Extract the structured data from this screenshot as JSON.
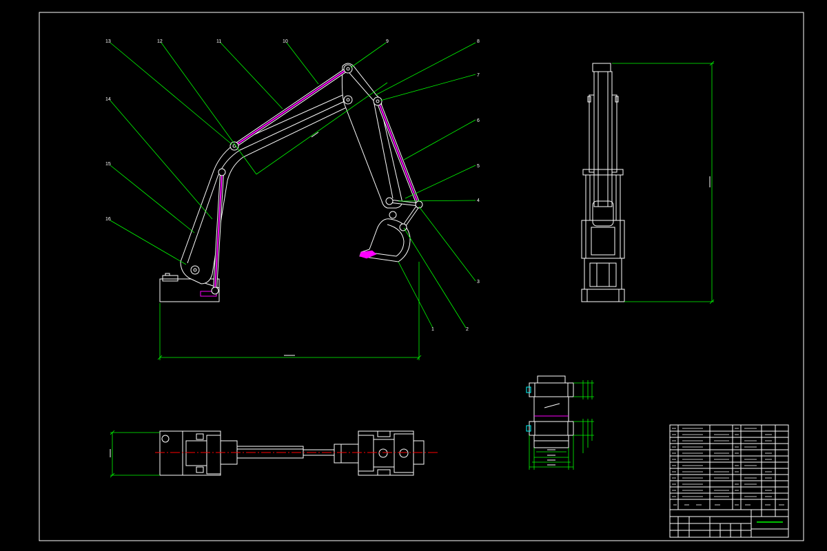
{
  "callouts": [
    "1",
    "2",
    "3",
    "4",
    "5",
    "6",
    "7",
    "8",
    "9",
    "10",
    "11",
    "12",
    "13",
    "14",
    "15",
    "16"
  ],
  "colors": {
    "background": "#000000",
    "outline": "#ffffff",
    "leader": "#00ff00",
    "cylinder": "#ff00ff",
    "centerline": "#ff0000",
    "accent": "#00ffff",
    "mark": "#9a9a9a"
  }
}
